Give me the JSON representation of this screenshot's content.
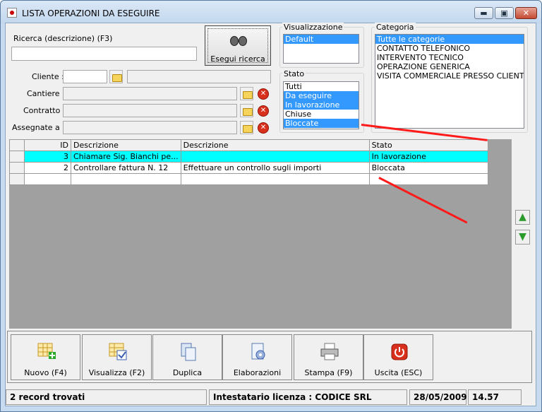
{
  "window": {
    "title": "LISTA OPERAZIONI DA ESEGUIRE",
    "min_glyph": "▬",
    "max_glyph": "▣",
    "close_glyph": "✕"
  },
  "search": {
    "label": "Ricerca (descrizione) (F3)",
    "value": "",
    "button_label": "Esegui ricerca"
  },
  "filters": {
    "cliente_label": "Cliente :",
    "cliente_value": "",
    "cliente_desc": "",
    "cantiere_label": "Cantiere :",
    "cantiere_value": "",
    "contratto_label": "Contratto :",
    "contratto_value": "",
    "assegnate_label": "Assegnate a :",
    "assegnate_value": ""
  },
  "visualizzazione": {
    "title": "Visualizzazione",
    "items": [
      {
        "label": "Default",
        "selected": true
      }
    ]
  },
  "stato": {
    "title": "Stato",
    "items": [
      {
        "label": "Tutti",
        "selected": false
      },
      {
        "label": "Da eseguire",
        "selected": true
      },
      {
        "label": "In lavorazione",
        "selected": true
      },
      {
        "label": "Chiuse",
        "selected": false
      },
      {
        "label": "Bloccate",
        "selected": true
      }
    ]
  },
  "categoria": {
    "title": "Categoria",
    "items": [
      {
        "label": "Tutte le categorie",
        "selected": true
      },
      {
        "label": "CONTATTO TELEFONICO",
        "selected": false
      },
      {
        "label": "INTERVENTO TECNICO",
        "selected": false
      },
      {
        "label": "OPERAZIONE GENERICA",
        "selected": false
      },
      {
        "label": "VISITA COMMERCIALE PRESSO CLIENTE",
        "selected": false
      }
    ]
  },
  "grid": {
    "columns": [
      "ID",
      "Descrizione",
      "Descrizione",
      "Stato"
    ],
    "rows": [
      {
        "id": "3",
        "descr1": "Chiamare Sig. Bianchi pe...",
        "descr2": "",
        "stato": "In lavorazione",
        "current": true
      },
      {
        "id": "2",
        "descr1": "Controllare fattura N. 12",
        "descr2": "Effettuare un controllo sugli importi",
        "stato": "Bloccata",
        "current": false
      },
      {
        "id": "",
        "descr1": "",
        "descr2": "",
        "stato": "",
        "current": false
      }
    ]
  },
  "toolbar": {
    "nuovo": "Nuovo (F4)",
    "visualizza": "Visualizza (F2)",
    "duplica": "Duplica",
    "elaborazioni": "Elaborazioni",
    "stampa": "Stampa (F9)",
    "uscita": "Uscita (ESC)"
  },
  "statusbar": {
    "records": "2 record trovati",
    "license": "Intestatario licenza : CODICE SRL",
    "date": "28/05/2009",
    "time": "14.57"
  },
  "colors": {
    "accent": "#3399ff",
    "current_row": "#00ffff",
    "annotation": "#ff1a1a"
  }
}
